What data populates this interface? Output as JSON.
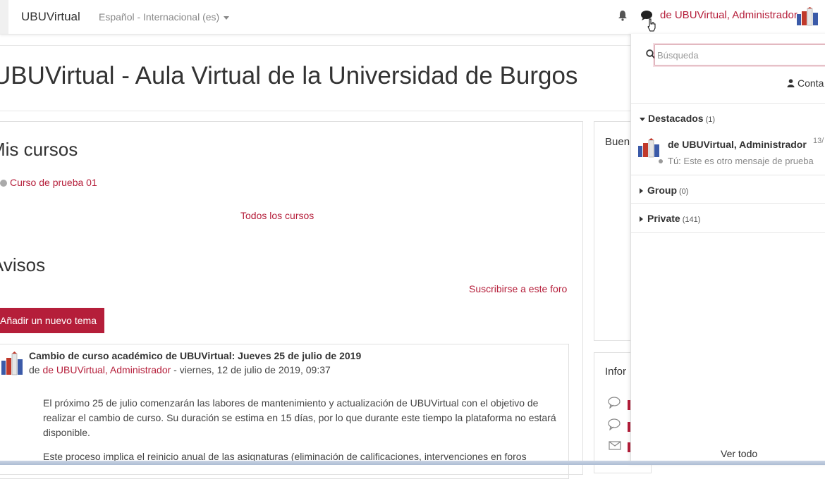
{
  "navbar": {
    "brand": "UBUVirtual",
    "language": "Español - Internacional (es)",
    "user_name": "de UBUVirtual, Administrador",
    "icons": [
      "bell-icon",
      "chat-icon",
      "user-avatar"
    ]
  },
  "page": {
    "title": "UBUVirtual - Aula Virtual de la Universidad de Burgos"
  },
  "main": {
    "my_courses_heading": "Mis cursos",
    "course_link": "Curso de prueba 01",
    "all_courses_link": "Todos los cursos",
    "news_heading": "Avisos",
    "subscribe_link": "Suscribirse a este foro",
    "add_topic_button": "Añadir un nuevo tema",
    "post": {
      "subject": "Cambio de curso académico de UBUVirtual: Jueves 25 de julio de 2019",
      "by_prefix": "de ",
      "author": "de UBUVirtual, Administrador",
      "date": " - viernes, 12 de julio de 2019, 09:37",
      "paragraph1": "El próximo 25 de julio comenzarán las labores de mantenimiento y actualización de UBUVirtual con el objetivo de realizar el cambio de curso. Su duración se estima en 15 días, por lo que durante este tiempo la plataforma no estará disponible.",
      "paragraph2": "Este proceso implica el reinicio anual de las asignaturas (eliminación de calificaciones, intervenciones en foros"
    }
  },
  "side_blocks": {
    "block1_title": "Buen",
    "block2_title": "Infor"
  },
  "drawer": {
    "search_placeholder": "Búsqueda",
    "contacts_label": "Conta",
    "sections": [
      {
        "label": "Destacados",
        "count": "(1)",
        "expanded": true
      },
      {
        "label": "Group",
        "count": "(0)",
        "expanded": false
      },
      {
        "label": "Private",
        "count": "(141)",
        "expanded": false
      }
    ],
    "conversation": {
      "name": "de UBUVirtual, Administrador",
      "date": "13/",
      "preview_prefix": "Tú:",
      "preview_text": " Este es otro mensaje de prueba"
    },
    "view_all": "Ver todo"
  },
  "colors": {
    "accent": "#b51e3a",
    "text": "#333333",
    "muted": "#888888"
  }
}
